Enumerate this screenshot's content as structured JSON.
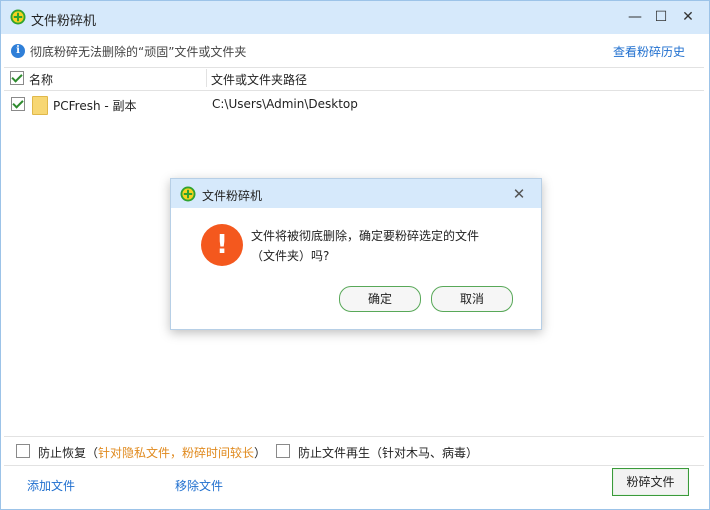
{
  "window": {
    "title": "文件粉碎机",
    "controls": {
      "minimize": "—",
      "maximize": "☐",
      "close": "✕"
    }
  },
  "infobar": {
    "text": "彻底粉碎无法删除的“顽固”文件或文件夹",
    "history_link": "查看粉碎历史"
  },
  "table": {
    "columns": [
      "名称",
      "文件或文件夹路径"
    ],
    "rows": [
      {
        "checked": true,
        "name": "PCFresh - 副本",
        "path": "C:\\Users\\Admin\\Desktop"
      }
    ]
  },
  "options": {
    "prevent_recovery": "防止恢复（",
    "prevent_recovery_note": "针对隐私文件，粉碎时间较长",
    "prevent_recovery_close": "）",
    "prevent_regen": "防止文件再生（针对木马、病毒）"
  },
  "footer": {
    "add_file": "添加文件",
    "remove_file": "移除文件",
    "shred_button": "粉碎文件"
  },
  "dialog": {
    "title": "文件粉碎机",
    "close": "✕",
    "icon": "!",
    "message_line1": "文件将被彻底删除，确定要粉碎选定的文件",
    "message_line2": "（文件夹）吗?",
    "ok": "确定",
    "cancel": "取消"
  },
  "colors": {
    "titlebar": "#d6e9fb",
    "link": "#1f6fcf",
    "accent_green": "#3a9a3a",
    "warning": "#f4581e",
    "note_orange": "#e08a1e"
  }
}
